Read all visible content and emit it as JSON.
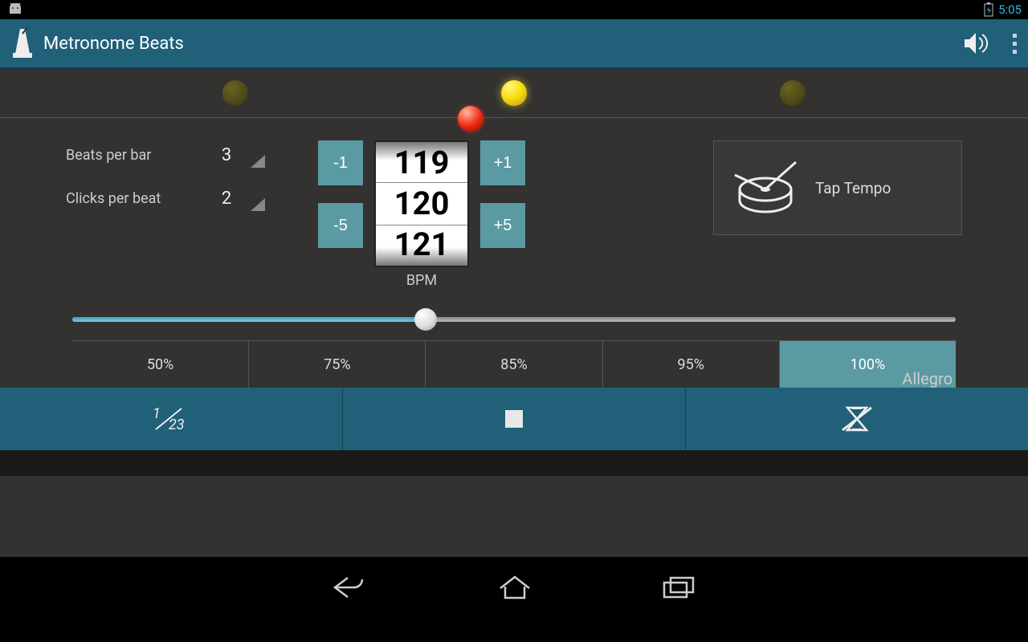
{
  "status": {
    "time": "5:05"
  },
  "app": {
    "title": "Metronome Beats"
  },
  "settings": {
    "beats_per_bar_label": "Beats per bar",
    "beats_per_bar_value": "3",
    "clicks_per_beat_label": "Clicks per beat",
    "clicks_per_beat_value": "2"
  },
  "tempo": {
    "minus1": "-1",
    "plus1": "+1",
    "minus5": "-5",
    "plus5": "+5",
    "wheel_prev": "119",
    "wheel_current": "120",
    "wheel_next": "121",
    "bpm_label": "BPM",
    "name": "Allegro",
    "slider_percent": 40
  },
  "tap": {
    "label": "Tap Tempo"
  },
  "percentages": {
    "items": [
      "50%",
      "75%",
      "85%",
      "95%",
      "100%"
    ],
    "active_index": 4
  },
  "leds": {
    "count": 3,
    "lit_index": 1
  },
  "colors": {
    "accent": "#206078",
    "button": "#5a9aa3"
  }
}
